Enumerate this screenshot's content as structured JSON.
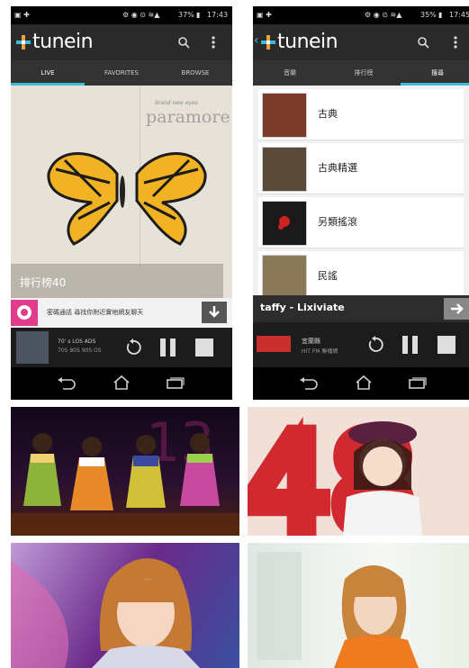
{
  "brand": "tunein",
  "accent": "#3dbbd8",
  "status_left": {
    "battery": "37%",
    "time": "17:43"
  },
  "status_right": {
    "battery": "35%",
    "time": "17:45"
  },
  "left_phone": {
    "tabs": [
      {
        "label": "LIVE"
      },
      {
        "label": "FAVORITES"
      },
      {
        "label": "BROWSE"
      }
    ],
    "album": {
      "band": "paramore",
      "small_text": "brand new eyes",
      "station_label": "排行榜40"
    },
    "banner": {
      "text": "密碼通話 尋找你附近實地網友聊天"
    },
    "now": {
      "line1": "70' s LOS ADS",
      "line2": "70S 80S 90S OS"
    }
  },
  "right_phone": {
    "tabs": [
      {
        "label": "音樂"
      },
      {
        "label": "排行榜"
      },
      {
        "label": "搜尋"
      }
    ],
    "items": [
      {
        "label": "古典"
      },
      {
        "label": "古典精選"
      },
      {
        "label": "另類搖滾"
      },
      {
        "label": "民謠"
      }
    ],
    "now_bar": {
      "title": "taffy - Lixiviate"
    },
    "now": {
      "line1": "宜蘭縣",
      "line2": "HIT FM 聯播網"
    }
  },
  "icons": [
    "search-icon",
    "menu-icon",
    "download-icon",
    "replay-icon",
    "pause-icon",
    "stop-icon",
    "back-icon",
    "home-icon",
    "recent-apps-icon",
    "forward-icon"
  ]
}
